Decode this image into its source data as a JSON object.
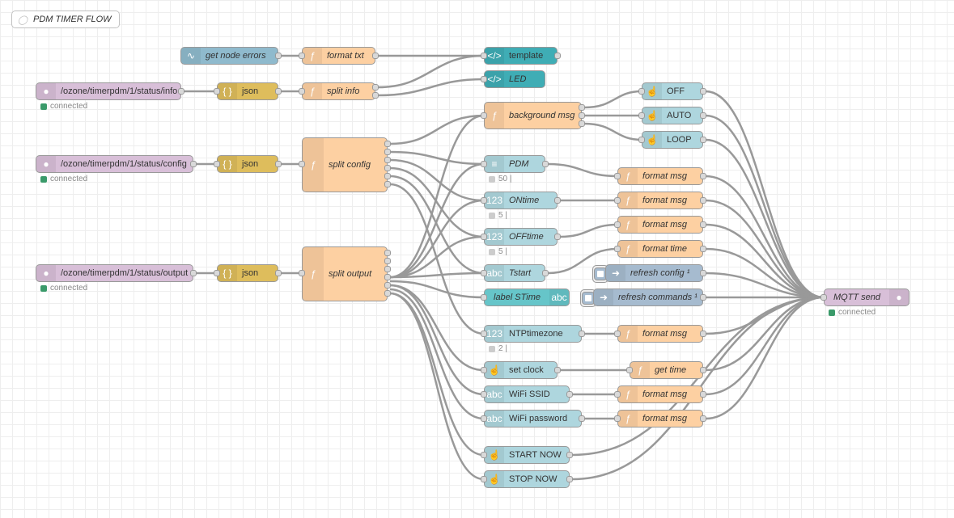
{
  "comment": {
    "text": "PDM TIMER FLOW",
    "icon": "comment-icon"
  },
  "colors": {
    "function": "#fdd0a2",
    "json": "#debd5c",
    "mqtt": "#d8bfd8",
    "dashboard": "#aed6de",
    "template": "#3fadb5",
    "catch": "#8fbacd",
    "inject": "#a6bbcf",
    "connected": "#3a9a6a"
  },
  "nodes": {
    "get_node_errors": "get node errors",
    "format_txt": "format txt",
    "template": "template",
    "led": "LED",
    "mqtt_info": "/ozone/timerpdm/1/status/info",
    "json1": "json",
    "split_info": "split info",
    "mqtt_config": "/ozone/timerpdm/1/status/config",
    "json2": "json",
    "split_config": "split config",
    "mqtt_output": "/ozone/timerpdm/1/status/output",
    "json3": "json",
    "split_output": "split output",
    "background_msg": "background msg",
    "off": "OFF",
    "auto": "AUTO",
    "loop": "LOOP",
    "pdm": "PDM",
    "ontime": "ONtime",
    "offtime": "OFFtime",
    "tstart": "Tstart",
    "label_stime": "label STime",
    "ntptimezone": "NTPtimezone",
    "set_clock": "set clock",
    "wifi_ssid": "WiFi SSID",
    "wifi_password": "WiFi password",
    "start_now": "START NOW",
    "stop_now": "STOP NOW",
    "format_msg1": "format msg",
    "format_msg2": "format msg",
    "format_msg3": "format msg",
    "format_time": "format time",
    "refresh_config": "refresh config ¹",
    "refresh_commands": "refresh commands ¹",
    "format_msg4": "format msg",
    "get_time": "get time",
    "format_msg5": "format msg",
    "format_msg6": "format msg",
    "mqtt_send": "MQTT send"
  },
  "statuses": {
    "connected": "connected",
    "pdm": "50 |",
    "ontime": "5 |",
    "offtime": "5 |",
    "ntptimezone": "2 |"
  }
}
